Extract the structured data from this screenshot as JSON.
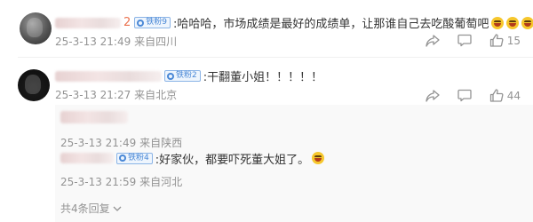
{
  "comments": [
    {
      "name_tail": "2",
      "badge": "铁粉9",
      "text": ":哈哈哈，市场成绩是最好的成绩单，让那谁自己去吃酸葡萄吧",
      "emoji_icons": [
        "grin-emoji",
        "grin-emoji",
        "grin-emoji"
      ],
      "time": "25-3-13 21:49",
      "location": "来自四川",
      "like_count": "15"
    },
    {
      "name_tail": "",
      "badge": "铁粉2",
      "text": ":干翻董小姐！！！！！",
      "time": "25-3-13 21:27",
      "location": "来自北京",
      "like_count": "44"
    }
  ],
  "replies": [
    {
      "time": "25-3-13 21:49",
      "location": "来自陕西"
    },
    {
      "badge": "铁粉4",
      "text": ":好家伙，都要吓死董大姐了。",
      "emoji_icons": [
        "grin-emoji"
      ],
      "time": "25-3-13 21:59",
      "location": "来自河北"
    }
  ],
  "more_replies_label": "共4条回复",
  "icons": {
    "share": "share-icon",
    "comment": "comment-icon",
    "like": "thumbs-up-icon",
    "expand": "chevron-down-icon"
  },
  "colors": {
    "username": "#eb7350",
    "badge": "#4a88d6",
    "meta": "#939393",
    "reply_bg": "#f9f9f9"
  }
}
